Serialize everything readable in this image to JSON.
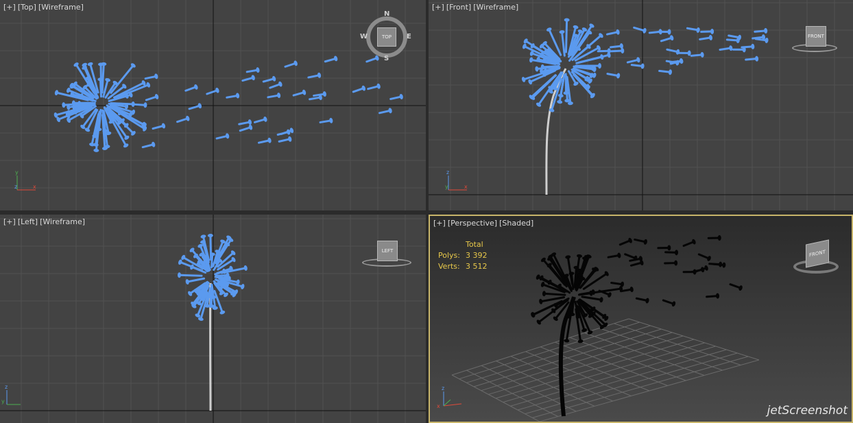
{
  "viewports": [
    {
      "id": "top",
      "labels": [
        "[+]",
        "[Top]",
        "[Wireframe]"
      ],
      "cube": "TOP",
      "compass": {
        "n": "N",
        "s": "S",
        "e": "E",
        "w": "W"
      }
    },
    {
      "id": "front",
      "labels": [
        "[+]",
        "[Front]",
        "[Wireframe]"
      ],
      "cube": "FRONT"
    },
    {
      "id": "left",
      "labels": [
        "[+]",
        "[Left]",
        "[Wireframe]"
      ],
      "cube": "LEFT"
    },
    {
      "id": "persp",
      "labels": [
        "[+]",
        "[Perspective]",
        "[Shaded]"
      ],
      "cube": "FRONT"
    }
  ],
  "stats": {
    "total": "Total",
    "polys_label": "Polys:",
    "polys": "3 392",
    "verts_label": "Verts:",
    "verts": "3 512"
  },
  "axes": {
    "top": {
      "a": "y",
      "b": "x",
      "c": "z"
    },
    "front": {
      "a": "z",
      "b": "x",
      "c": "y"
    },
    "left": {
      "a": "z",
      "b": "y",
      "c": "x"
    },
    "persp": {
      "a": "z",
      "b": "x",
      "c": "y"
    }
  },
  "watermark": "jetScreenshot",
  "colors": {
    "wire": "#5b9aef",
    "bg": "#434343",
    "grid": "#525252",
    "axis": "#111111",
    "active": "#c8b56a"
  }
}
